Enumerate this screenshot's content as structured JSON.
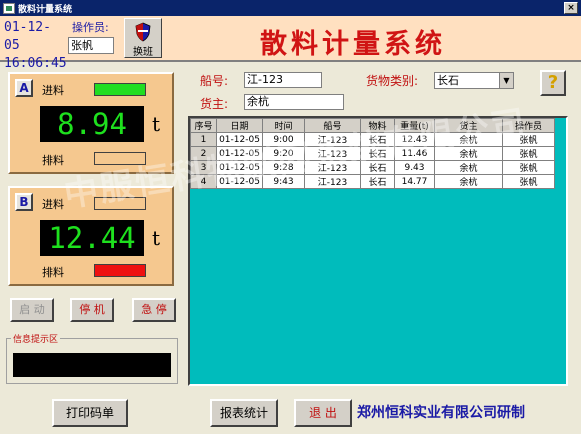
{
  "window": {
    "title": "散料计量系统",
    "close_glyph": "×"
  },
  "header": {
    "date": "01-12-05",
    "time": "16:06:45",
    "operator_label": "操作员:",
    "operator_value": "张帆",
    "shift_button_label": "换班",
    "app_title": "散料计量系统"
  },
  "scales": [
    {
      "letter": "A",
      "in_label": "进料",
      "out_label": "排料",
      "reading": "8.94",
      "unit": "t",
      "in_light_color": "#22dd22",
      "out_light_color": "#f5c88f"
    },
    {
      "letter": "B",
      "in_label": "进料",
      "out_label": "排料",
      "reading": "12.44",
      "unit": "t",
      "in_light_color": "#f5c88f",
      "out_light_color": "#ee1111"
    }
  ],
  "controls": {
    "start_label": "启 动",
    "stop_label": "停 机",
    "emergency_label": "急 停"
  },
  "info": {
    "legend": "信息提示区"
  },
  "form": {
    "ship_label": "船号:",
    "ship_value": "江-123",
    "owner_label": "货主:",
    "owner_value": "余杭",
    "cargo_type_label": "货物类别:",
    "cargo_type_value": "长石",
    "help_glyph": "?"
  },
  "table": {
    "columns": [
      "序号",
      "日期",
      "时间",
      "船号",
      "物料",
      "重量(t)",
      "货主",
      "操作员"
    ],
    "rows": [
      [
        "1",
        "01-12-05",
        "9:00",
        "江-123",
        "长石",
        "12.43",
        "余杭",
        "张帆"
      ],
      [
        "2",
        "01-12-05",
        "9:20",
        "江-123",
        "长石",
        "11.46",
        "余杭",
        "张帆"
      ],
      [
        "3",
        "01-12-05",
        "9:28",
        "江-123",
        "长石",
        "9.43",
        "余杭",
        "张帆"
      ],
      [
        "4",
        "01-12-05",
        "9:43",
        "江-123",
        "长石",
        "14.77",
        "余杭",
        "张帆"
      ]
    ]
  },
  "footer": {
    "print_label": "打印码单",
    "report_label": "报表统计",
    "exit_label": "退 出",
    "credit": "郑州恒科实业有限公司研制"
  },
  "watermark": {
    "text": "中服恒科物联网系统有限公司"
  }
}
